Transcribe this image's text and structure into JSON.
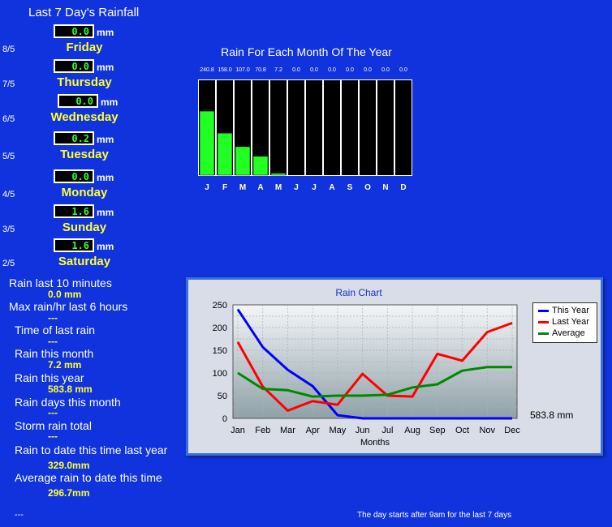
{
  "title": "Last 7 Day's Rainfall",
  "unit": "mm",
  "days": [
    {
      "date": "8/5",
      "value": "0.0",
      "name": "Friday"
    },
    {
      "date": "7/5",
      "value": "0.0",
      "name": "Thursday"
    },
    {
      "date": "6/5",
      "value": "0.0",
      "name": "Wednesday"
    },
    {
      "date": "5/5",
      "value": "0.2",
      "name": "Tuesday"
    },
    {
      "date": "4/5",
      "value": "0.0",
      "name": "Monday"
    },
    {
      "date": "3/5",
      "value": "1.6",
      "name": "Sunday"
    },
    {
      "date": "2/5",
      "value": "1.6",
      "name": "Saturday"
    }
  ],
  "stats": {
    "rain_10min_label": "Rain last 10 minutes",
    "rain_10min_value": "0.0 mm",
    "max_rain_label": "Max rain/hr last 6 hours",
    "max_rain_value": "---",
    "time_last_rain_label": "Time of last rain",
    "time_last_rain_value": "---",
    "rain_month_label": "Rain this month",
    "rain_month_value": "7.2 mm",
    "rain_year_label": "Rain this year",
    "rain_year_value": "583.8 mm",
    "rain_days_label": "Rain days this month",
    "rain_days_value": "---",
    "storm_label": "Storm rain total",
    "storm_value": "---",
    "last_year_label": "Rain to date this time last year",
    "last_year_value": "329.0mm",
    "avg_label": "Average rain to date this time",
    "avg_value": "296.7mm"
  },
  "footer": {
    "left": "---",
    "right": "The day starts after 9am for the last 7 days"
  },
  "chart_data": [
    {
      "type": "bar",
      "title": "Rain For Each Month Of The Year",
      "categories": [
        "J",
        "F",
        "M",
        "A",
        "M",
        "J",
        "J",
        "A",
        "S",
        "O",
        "N",
        "D"
      ],
      "values": [
        240.8,
        158.0,
        107.0,
        70.8,
        7.2,
        0.0,
        0.0,
        0.0,
        0.0,
        0.0,
        0.0,
        0.0
      ],
      "value_labels": [
        "240.8",
        "158.0",
        "107.0",
        "70.8",
        "7.2",
        "0.0",
        "0.0",
        "0.0",
        "0.0",
        "0.0",
        "0.0",
        "0.0"
      ],
      "ylim": [
        0,
        360
      ],
      "bar_color": "#22ff22"
    },
    {
      "type": "line",
      "title": "Rain Chart",
      "xlabel": "Months",
      "ylabel": "",
      "categories": [
        "Jan",
        "Feb",
        "Mar",
        "Apr",
        "May",
        "Jun",
        "Jul",
        "Aug",
        "Sep",
        "Oct",
        "Nov",
        "Dec"
      ],
      "ylim": [
        0,
        250
      ],
      "yticks": [
        0,
        25,
        50,
        75,
        100,
        125,
        150,
        175,
        200,
        225,
        250
      ],
      "yticklabels": [
        "0",
        "25",
        "50",
        "75",
        "100",
        "125",
        "150",
        "175",
        "200",
        "225",
        "250"
      ],
      "grid": true,
      "legend": "top-right",
      "series": [
        {
          "name": "This Year",
          "color": "#0000ff",
          "values": [
            240,
            157,
            107,
            71,
            7,
            0,
            0,
            0,
            0,
            0,
            0,
            0
          ]
        },
        {
          "name": "Last Year",
          "color": "#ff0000",
          "values": [
            168,
            70,
            17,
            38,
            30,
            98,
            50,
            48,
            142,
            127,
            190,
            210
          ]
        },
        {
          "name": "Average",
          "color": "#008800",
          "values": [
            100,
            65,
            62,
            48,
            50,
            50,
            52,
            68,
            75,
            105,
            113,
            113
          ]
        }
      ],
      "annotation": "583.8 mm"
    }
  ]
}
